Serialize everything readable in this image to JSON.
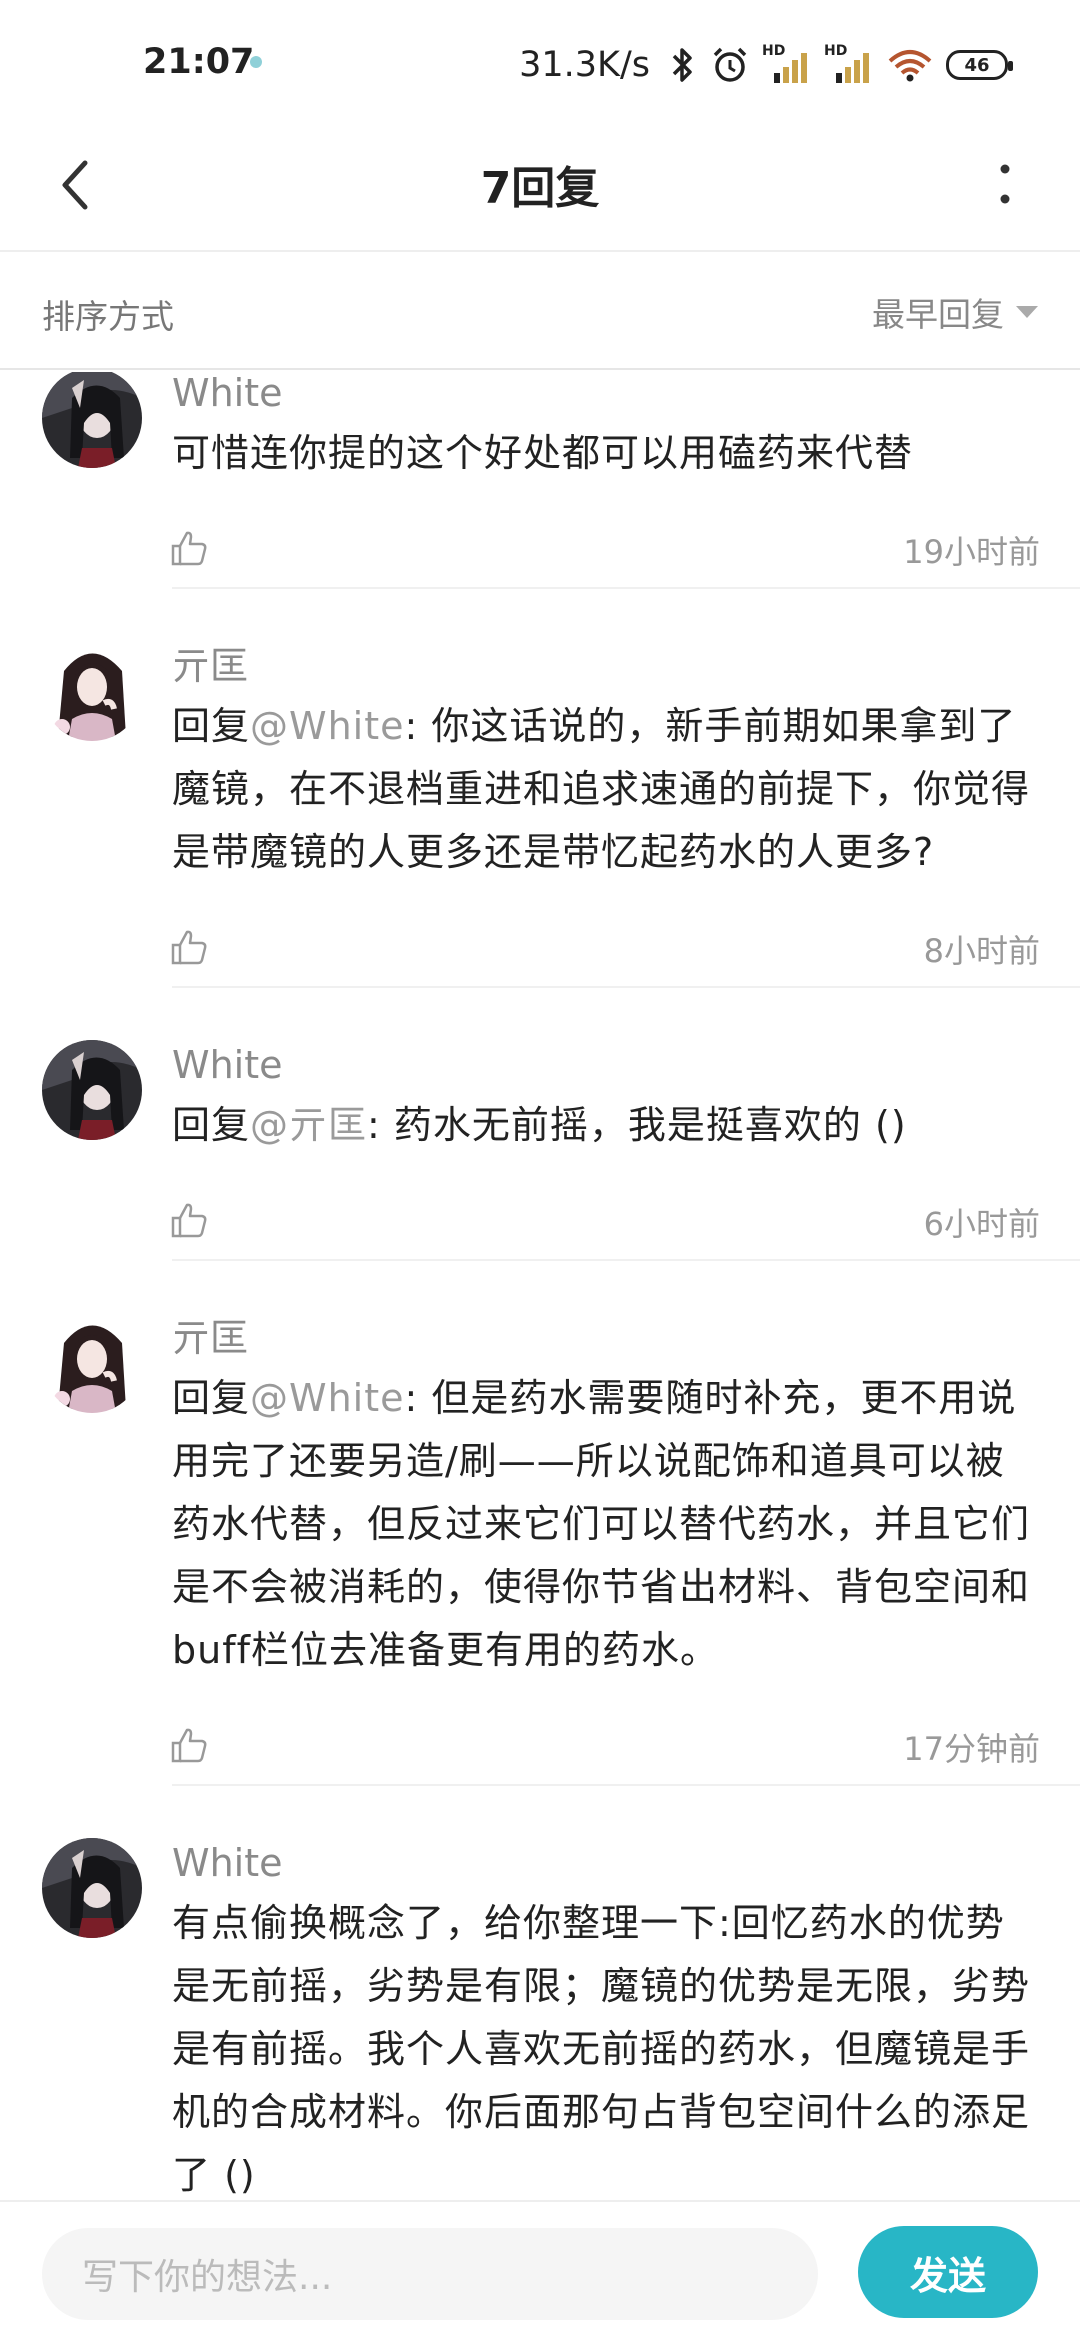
{
  "status_bar": {
    "time": "21:07",
    "net_speed": "31.3K/s",
    "battery": "46",
    "signal_1_label": "HD",
    "signal_2_label": "HD",
    "icons": [
      "bluetooth-icon",
      "alarm-icon",
      "signal-icon",
      "signal-icon",
      "wifi-icon",
      "battery-icon"
    ]
  },
  "header": {
    "title": "7回复",
    "back_icon": "chevron-left-icon",
    "more_icon": "more-vertical-icon"
  },
  "sort": {
    "label": "排序方式",
    "selected": "最早回复"
  },
  "comments": [
    {
      "user": "White",
      "avatar": "avatar-white",
      "text": "可惜连你提的这个好处都可以用磕药来代替",
      "reply_prefix": "",
      "mention": "",
      "body": "",
      "time": "19小时前"
    },
    {
      "user": "亓匡",
      "avatar": "avatar-qikuang",
      "reply_prefix": "回复",
      "mention": "@White",
      "body": ": 你这话说的，新手前期如果拿到了魔镜，在不退档重进和追求速通的前提下，你觉得是带魔镜的人更多还是带忆起药水的人更多?",
      "time": "8小时前"
    },
    {
      "user": "White",
      "avatar": "avatar-white",
      "reply_prefix": "回复",
      "mention": "@亓匡",
      "body": ": 药水无前摇，我是挺喜欢的 ()",
      "time": "6小时前"
    },
    {
      "user": "亓匡",
      "avatar": "avatar-qikuang",
      "reply_prefix": "回复",
      "mention": "@White",
      "body": ": 但是药水需要随时补充，更不用说用完了还要另造/刷——所以说配饰和道具可以被药水代替，但反过来它们可以替代药水，并且它们是不会被消耗的，使得你节省出材料、背包空间和buff栏位去准备更有用的药水。",
      "time": "17分钟前"
    },
    {
      "user": "White",
      "avatar": "avatar-white",
      "text": "有点偷换概念了，给你整理一下:回忆药水的优势是无前摇，劣势是有限；魔镜的优势是无限，劣势是有前摇。我个人喜欢无前摇的药水，但魔镜是手机的合成材料。你后面那句占背包空间什么的添足了 ()",
      "time": ""
    }
  ],
  "composer": {
    "placeholder": "写下你的想法...",
    "send_label": "发送"
  },
  "colors": {
    "accent": "#28b6c6",
    "secondary_text": "#8a8a8a",
    "mention": "#9a9a9a"
  }
}
